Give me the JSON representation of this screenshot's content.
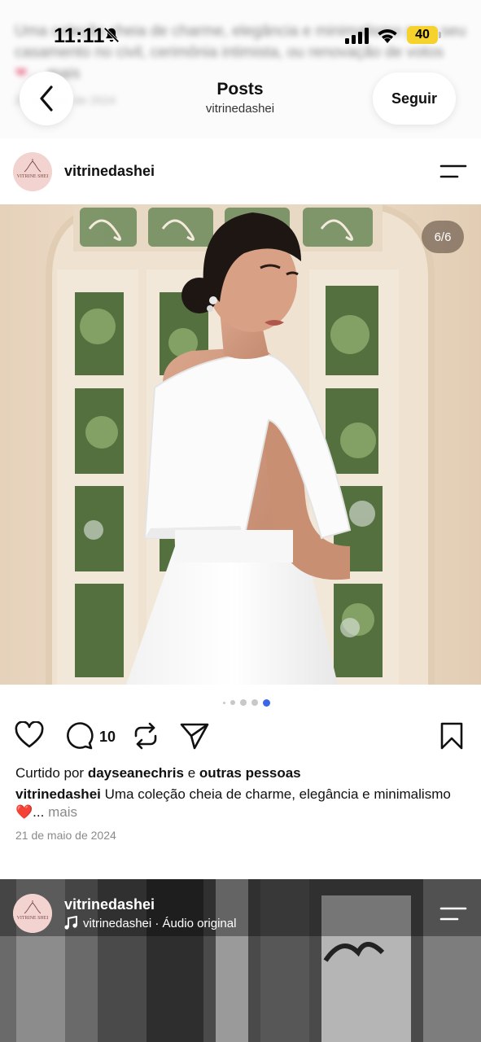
{
  "status_bar": {
    "time": "11:11",
    "battery": "40",
    "battery_color": "#f6d22d",
    "icons": [
      "bell-muted-icon",
      "signal-icon",
      "wifi-icon",
      "battery-icon"
    ]
  },
  "background_caption": {
    "text": "Uma coleção cheia de charme, elegância e minimalismo para seu casamento no civil, cerimônia intimista, ou renovação de votos",
    "more": "mais",
    "date": "21 de maio de 2024"
  },
  "nav": {
    "title": "Posts",
    "subtitle": "vitrinedashei",
    "follow_label": "Seguir",
    "back_icon": "chevron-left-icon"
  },
  "post": {
    "username": "vitrinedashei",
    "avatar_text": "VITRINE SHEI",
    "avatar_color": "#f3d3cf",
    "counter": "6/6",
    "carousel": {
      "total": 6,
      "current": 6,
      "active_color": "#3b66e8"
    },
    "comment_count": "10",
    "liked_prefix": "Curtido por",
    "liked_user": "dayseanechris",
    "liked_and": "e",
    "liked_others": "outras pessoas",
    "caption_user": "vitrinedashei",
    "caption_text": "Uma coleção cheia de charme, elegância e minimalismo❤️",
    "caption_ellipsis": "...",
    "caption_more": "mais",
    "date": "21 de maio de 2024"
  },
  "next_post": {
    "username": "vitrinedashei",
    "audio_text": "vitrinedashei · Áudio original",
    "audio_icon": "music-note-icon"
  }
}
